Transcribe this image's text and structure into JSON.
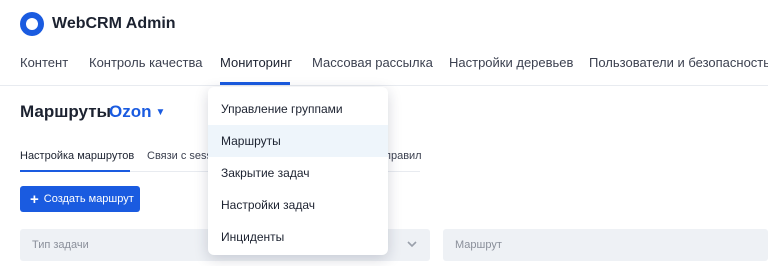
{
  "app": {
    "title": "WebCRM Admin"
  },
  "nav": {
    "items": [
      {
        "label": "Контент"
      },
      {
        "label": "Контроль качества"
      },
      {
        "label": "Мониторинг"
      },
      {
        "label": "Массовая рассылка"
      },
      {
        "label": "Настройки деревьев"
      },
      {
        "label": "Пользователи и безопасность"
      }
    ],
    "active_index": 2
  },
  "page": {
    "title": "Маршруты",
    "project": "Ozon"
  },
  "subtabs": [
    {
      "label": "Настройка маршрутов"
    },
    {
      "label": "Связи с sess"
    },
    {
      "label": "правил"
    }
  ],
  "actions": {
    "create_route": "Создать маршрут"
  },
  "filters": {
    "task_type_placeholder": "Тип задачи",
    "route_placeholder": "Маршрут"
  },
  "dropdown": {
    "items": [
      {
        "label": "Управление группами"
      },
      {
        "label": "Маршруты"
      },
      {
        "label": "Закрытие задач"
      },
      {
        "label": "Настройки задач"
      },
      {
        "label": "Инциденты"
      }
    ],
    "highlighted_index": 1
  },
  "colors": {
    "accent": "#1a5be0",
    "dropdown_hover": "#eef5fb",
    "filter_bg": "#eef1f5"
  }
}
